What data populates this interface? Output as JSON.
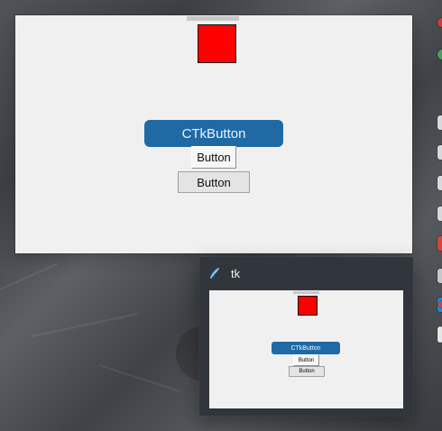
{
  "colors": {
    "red_box": "#ff0000",
    "ctk_blue": "#1f6aa5",
    "preview_bg": "#30363c"
  },
  "main_window": {
    "ctk_button_label": "CTkButton",
    "button_1_label": "Button",
    "button_2_label": "Button"
  },
  "taskbar_preview": {
    "title": "tk",
    "icon": "feather-icon",
    "ctk_button_label": "CTkButton",
    "button_1_label": "Button",
    "button_2_label": "Button"
  }
}
